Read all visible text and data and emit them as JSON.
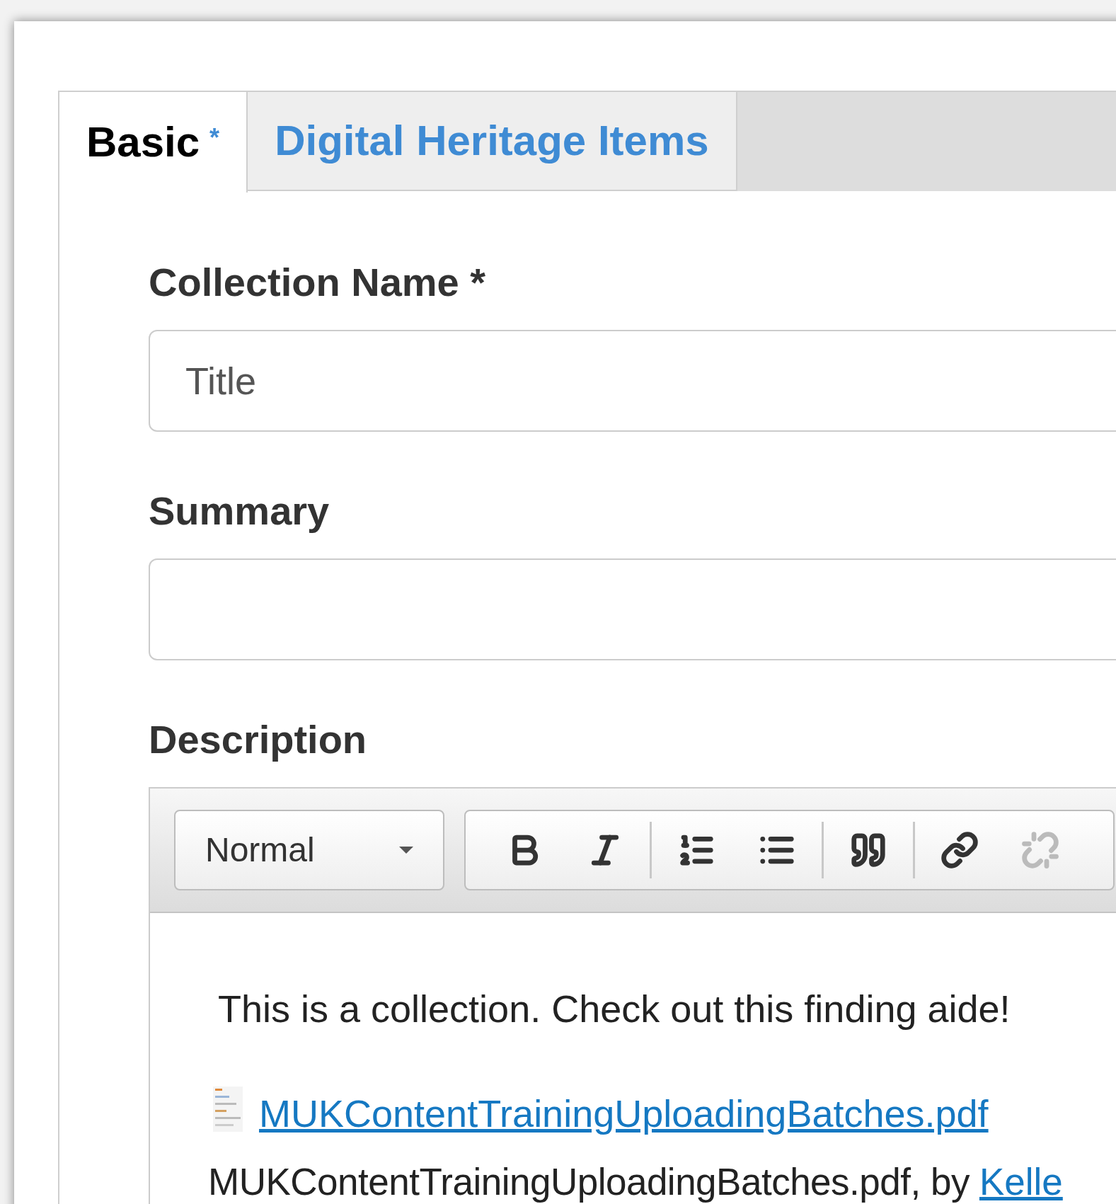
{
  "tabs": [
    {
      "label": "Basic",
      "required_mark": "*",
      "selected": true
    },
    {
      "label": "Digital Heritage Items",
      "selected": false
    }
  ],
  "fields": [
    {
      "label": "Collection Name *",
      "value": "Title"
    },
    {
      "label": "Summary"
    }
  ],
  "description": {
    "label": "Description",
    "toolbar": {
      "format": {
        "value": "Normal"
      },
      "groups": [
        [
          {
            "kind": "bold",
            "disabled": false
          },
          {
            "kind": "italic",
            "disabled": false
          }
        ],
        [
          {
            "kind": "numbered-list",
            "disabled": false
          },
          {
            "kind": "bullet-list",
            "disabled": false
          }
        ],
        [
          {
            "kind": "quote",
            "disabled": false
          }
        ],
        [
          {
            "kind": "link",
            "disabled": false
          },
          {
            "kind": "unlink",
            "disabled": true
          }
        ]
      ]
    },
    "paragraph": "This is a collection. Check out this finding aide!",
    "attachment_link": "MUKContentTrainingUploadingBatches.pdf",
    "attachment_caption": "MUKContentTrainingUploadingBatches.pdf, by",
    "author_link": "Kelle"
  }
}
